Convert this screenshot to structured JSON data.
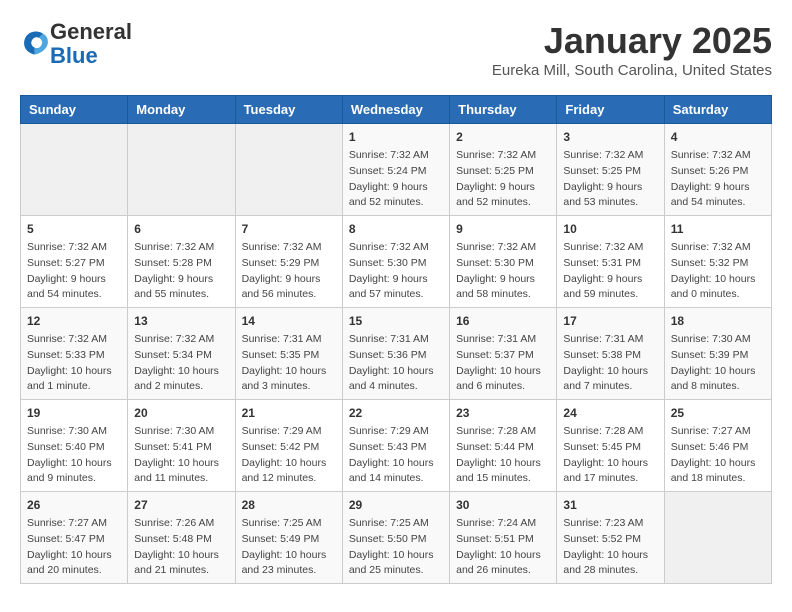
{
  "logo": {
    "general": "General",
    "blue": "Blue"
  },
  "title": "January 2025",
  "location": "Eureka Mill, South Carolina, United States",
  "days_of_week": [
    "Sunday",
    "Monday",
    "Tuesday",
    "Wednesday",
    "Thursday",
    "Friday",
    "Saturday"
  ],
  "weeks": [
    [
      {
        "day": "",
        "content": ""
      },
      {
        "day": "",
        "content": ""
      },
      {
        "day": "",
        "content": ""
      },
      {
        "day": "1",
        "content": "Sunrise: 7:32 AM\nSunset: 5:24 PM\nDaylight: 9 hours\nand 52 minutes."
      },
      {
        "day": "2",
        "content": "Sunrise: 7:32 AM\nSunset: 5:25 PM\nDaylight: 9 hours\nand 52 minutes."
      },
      {
        "day": "3",
        "content": "Sunrise: 7:32 AM\nSunset: 5:25 PM\nDaylight: 9 hours\nand 53 minutes."
      },
      {
        "day": "4",
        "content": "Sunrise: 7:32 AM\nSunset: 5:26 PM\nDaylight: 9 hours\nand 54 minutes."
      }
    ],
    [
      {
        "day": "5",
        "content": "Sunrise: 7:32 AM\nSunset: 5:27 PM\nDaylight: 9 hours\nand 54 minutes."
      },
      {
        "day": "6",
        "content": "Sunrise: 7:32 AM\nSunset: 5:28 PM\nDaylight: 9 hours\nand 55 minutes."
      },
      {
        "day": "7",
        "content": "Sunrise: 7:32 AM\nSunset: 5:29 PM\nDaylight: 9 hours\nand 56 minutes."
      },
      {
        "day": "8",
        "content": "Sunrise: 7:32 AM\nSunset: 5:30 PM\nDaylight: 9 hours\nand 57 minutes."
      },
      {
        "day": "9",
        "content": "Sunrise: 7:32 AM\nSunset: 5:30 PM\nDaylight: 9 hours\nand 58 minutes."
      },
      {
        "day": "10",
        "content": "Sunrise: 7:32 AM\nSunset: 5:31 PM\nDaylight: 9 hours\nand 59 minutes."
      },
      {
        "day": "11",
        "content": "Sunrise: 7:32 AM\nSunset: 5:32 PM\nDaylight: 10 hours\nand 0 minutes."
      }
    ],
    [
      {
        "day": "12",
        "content": "Sunrise: 7:32 AM\nSunset: 5:33 PM\nDaylight: 10 hours\nand 1 minute."
      },
      {
        "day": "13",
        "content": "Sunrise: 7:32 AM\nSunset: 5:34 PM\nDaylight: 10 hours\nand 2 minutes."
      },
      {
        "day": "14",
        "content": "Sunrise: 7:31 AM\nSunset: 5:35 PM\nDaylight: 10 hours\nand 3 minutes."
      },
      {
        "day": "15",
        "content": "Sunrise: 7:31 AM\nSunset: 5:36 PM\nDaylight: 10 hours\nand 4 minutes."
      },
      {
        "day": "16",
        "content": "Sunrise: 7:31 AM\nSunset: 5:37 PM\nDaylight: 10 hours\nand 6 minutes."
      },
      {
        "day": "17",
        "content": "Sunrise: 7:31 AM\nSunset: 5:38 PM\nDaylight: 10 hours\nand 7 minutes."
      },
      {
        "day": "18",
        "content": "Sunrise: 7:30 AM\nSunset: 5:39 PM\nDaylight: 10 hours\nand 8 minutes."
      }
    ],
    [
      {
        "day": "19",
        "content": "Sunrise: 7:30 AM\nSunset: 5:40 PM\nDaylight: 10 hours\nand 9 minutes."
      },
      {
        "day": "20",
        "content": "Sunrise: 7:30 AM\nSunset: 5:41 PM\nDaylight: 10 hours\nand 11 minutes."
      },
      {
        "day": "21",
        "content": "Sunrise: 7:29 AM\nSunset: 5:42 PM\nDaylight: 10 hours\nand 12 minutes."
      },
      {
        "day": "22",
        "content": "Sunrise: 7:29 AM\nSunset: 5:43 PM\nDaylight: 10 hours\nand 14 minutes."
      },
      {
        "day": "23",
        "content": "Sunrise: 7:28 AM\nSunset: 5:44 PM\nDaylight: 10 hours\nand 15 minutes."
      },
      {
        "day": "24",
        "content": "Sunrise: 7:28 AM\nSunset: 5:45 PM\nDaylight: 10 hours\nand 17 minutes."
      },
      {
        "day": "25",
        "content": "Sunrise: 7:27 AM\nSunset: 5:46 PM\nDaylight: 10 hours\nand 18 minutes."
      }
    ],
    [
      {
        "day": "26",
        "content": "Sunrise: 7:27 AM\nSunset: 5:47 PM\nDaylight: 10 hours\nand 20 minutes."
      },
      {
        "day": "27",
        "content": "Sunrise: 7:26 AM\nSunset: 5:48 PM\nDaylight: 10 hours\nand 21 minutes."
      },
      {
        "day": "28",
        "content": "Sunrise: 7:25 AM\nSunset: 5:49 PM\nDaylight: 10 hours\nand 23 minutes."
      },
      {
        "day": "29",
        "content": "Sunrise: 7:25 AM\nSunset: 5:50 PM\nDaylight: 10 hours\nand 25 minutes."
      },
      {
        "day": "30",
        "content": "Sunrise: 7:24 AM\nSunset: 5:51 PM\nDaylight: 10 hours\nand 26 minutes."
      },
      {
        "day": "31",
        "content": "Sunrise: 7:23 AM\nSunset: 5:52 PM\nDaylight: 10 hours\nand 28 minutes."
      },
      {
        "day": "",
        "content": ""
      }
    ]
  ]
}
